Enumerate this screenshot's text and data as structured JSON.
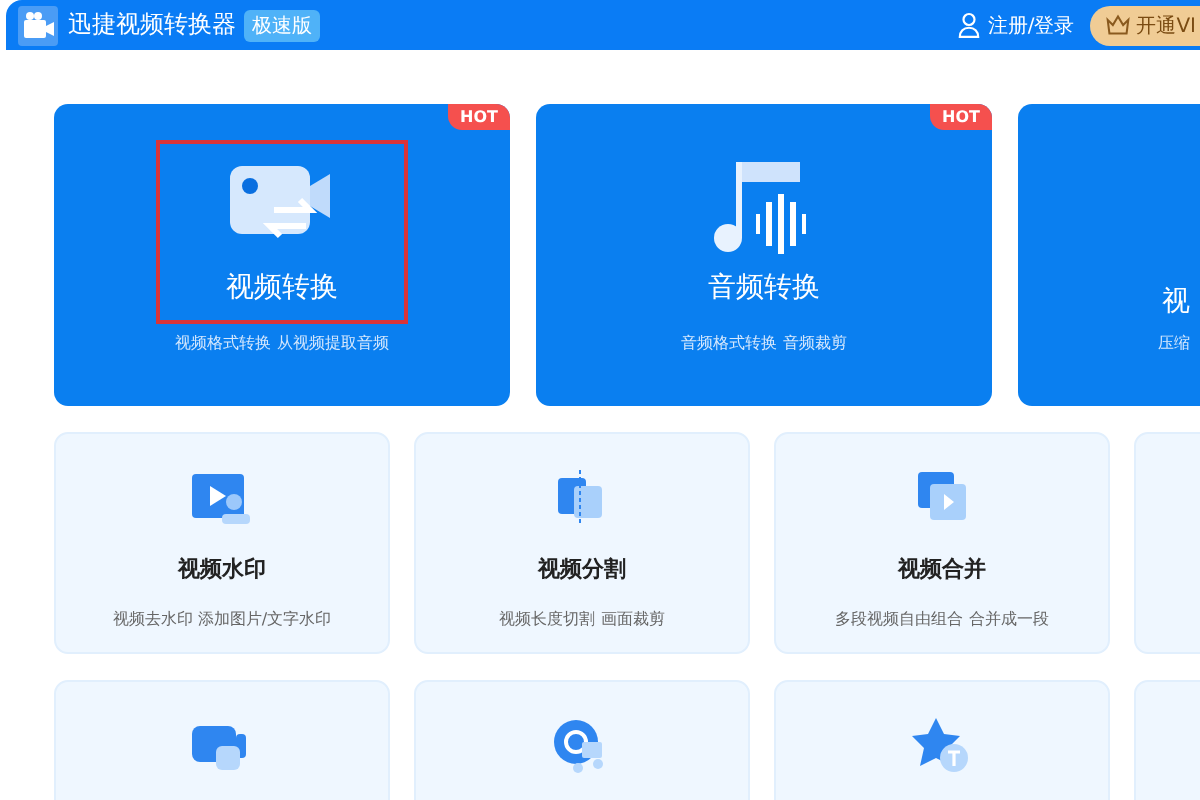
{
  "header": {
    "app_title": "迅捷视频转换器",
    "edition_badge": "极速版",
    "login": "注册/登录",
    "vip_button": "开通VI"
  },
  "main_features": [
    {
      "title": "视频转换",
      "description": "视频格式转换 从视频提取音频",
      "badge": "HOT",
      "highlighted": true
    },
    {
      "title": "音频转换",
      "description": "音频格式转换 音频裁剪",
      "badge": "HOT",
      "highlighted": false
    },
    {
      "title": "视",
      "description": "压缩",
      "highlighted": false
    }
  ],
  "tool_rows": [
    [
      {
        "title": "视频水印",
        "description": "视频去水印 添加图片/文字水印"
      },
      {
        "title": "视频分割",
        "description": "视频长度切割 画面裁剪"
      },
      {
        "title": "视频合并",
        "description": "多段视频自由组合 合并成一段"
      },
      {}
    ],
    [
      {},
      {},
      {},
      {}
    ]
  ]
}
